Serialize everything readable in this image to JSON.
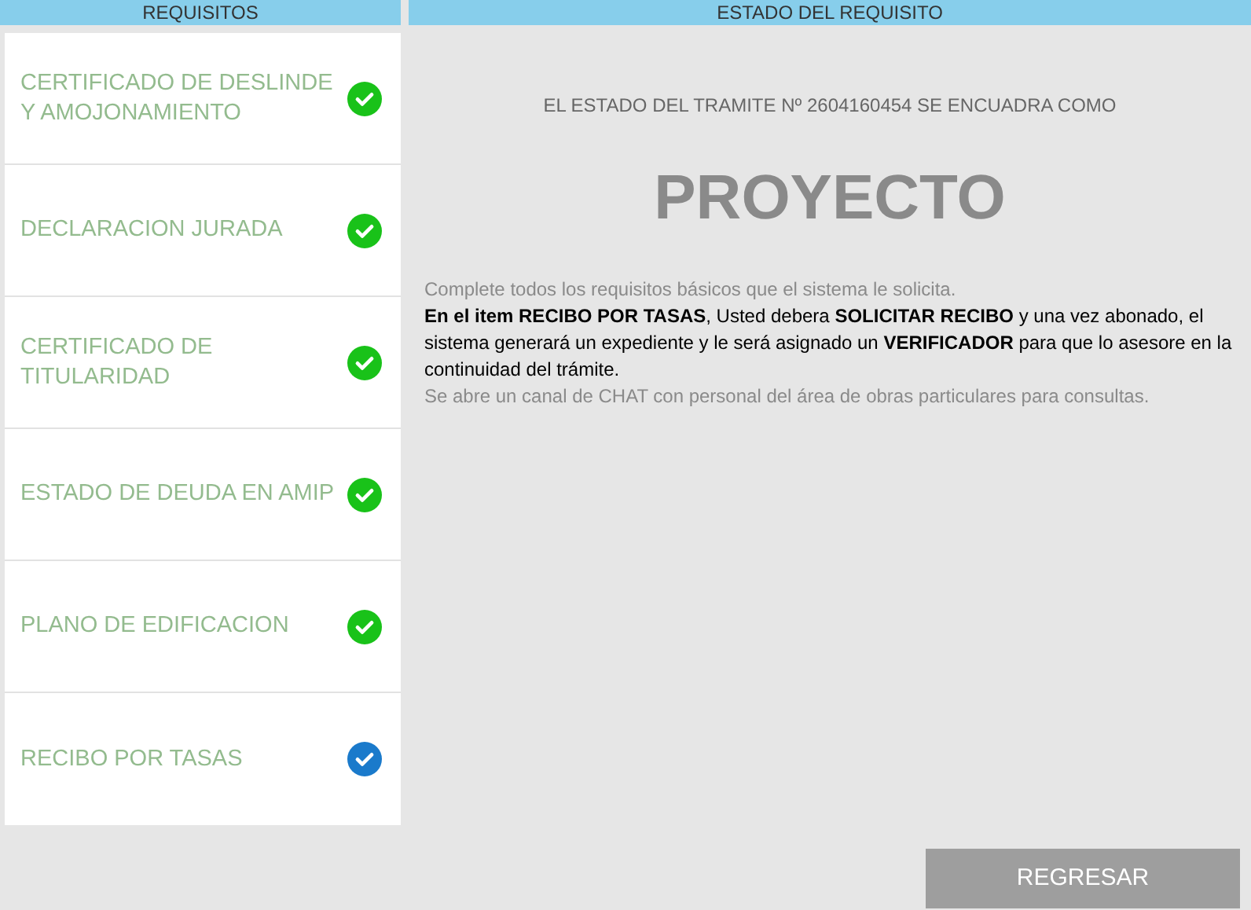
{
  "requirements": {
    "header": "REQUISITOS",
    "items": [
      {
        "label": "CERTIFICADO DE DESLINDE Y AMOJONAMIENTO",
        "color": "#19c219"
      },
      {
        "label": "DECLARACION JURADA",
        "color": "#19c219"
      },
      {
        "label": "CERTIFICADO DE TITULARIDAD",
        "color": "#19c219"
      },
      {
        "label": "ESTADO DE DEUDA EN AMIP",
        "color": "#19c219"
      },
      {
        "label": "PLANO DE EDIFICACION",
        "color": "#19c219"
      },
      {
        "label": "RECIBO POR TASAS",
        "color": "#1a7acb"
      }
    ]
  },
  "status": {
    "header": "ESTADO DEL REQUISITO",
    "caption": "EL ESTADO DEL TRAMITE Nº 2604160454 SE ENCUADRA COMO",
    "state": "PROYECTO",
    "messages": [
      {
        "kind": "note",
        "text": "Complete todos los requisitos básicos que el sistema le solicita."
      },
      {
        "kind": "instruction",
        "text": "**En el item RECIBO POR TASAS**, Usted debera **SOLICITAR RECIBO** y una vez abonado, el sistema generará un expediente y le será asignado un **VERIFICADOR** para que lo asesore en la continuidad del trámite."
      },
      {
        "kind": "note",
        "text": "Se abre un canal de CHAT con personal del área de obras particulares para consultas."
      }
    ]
  },
  "back_button": "REGRESAR"
}
